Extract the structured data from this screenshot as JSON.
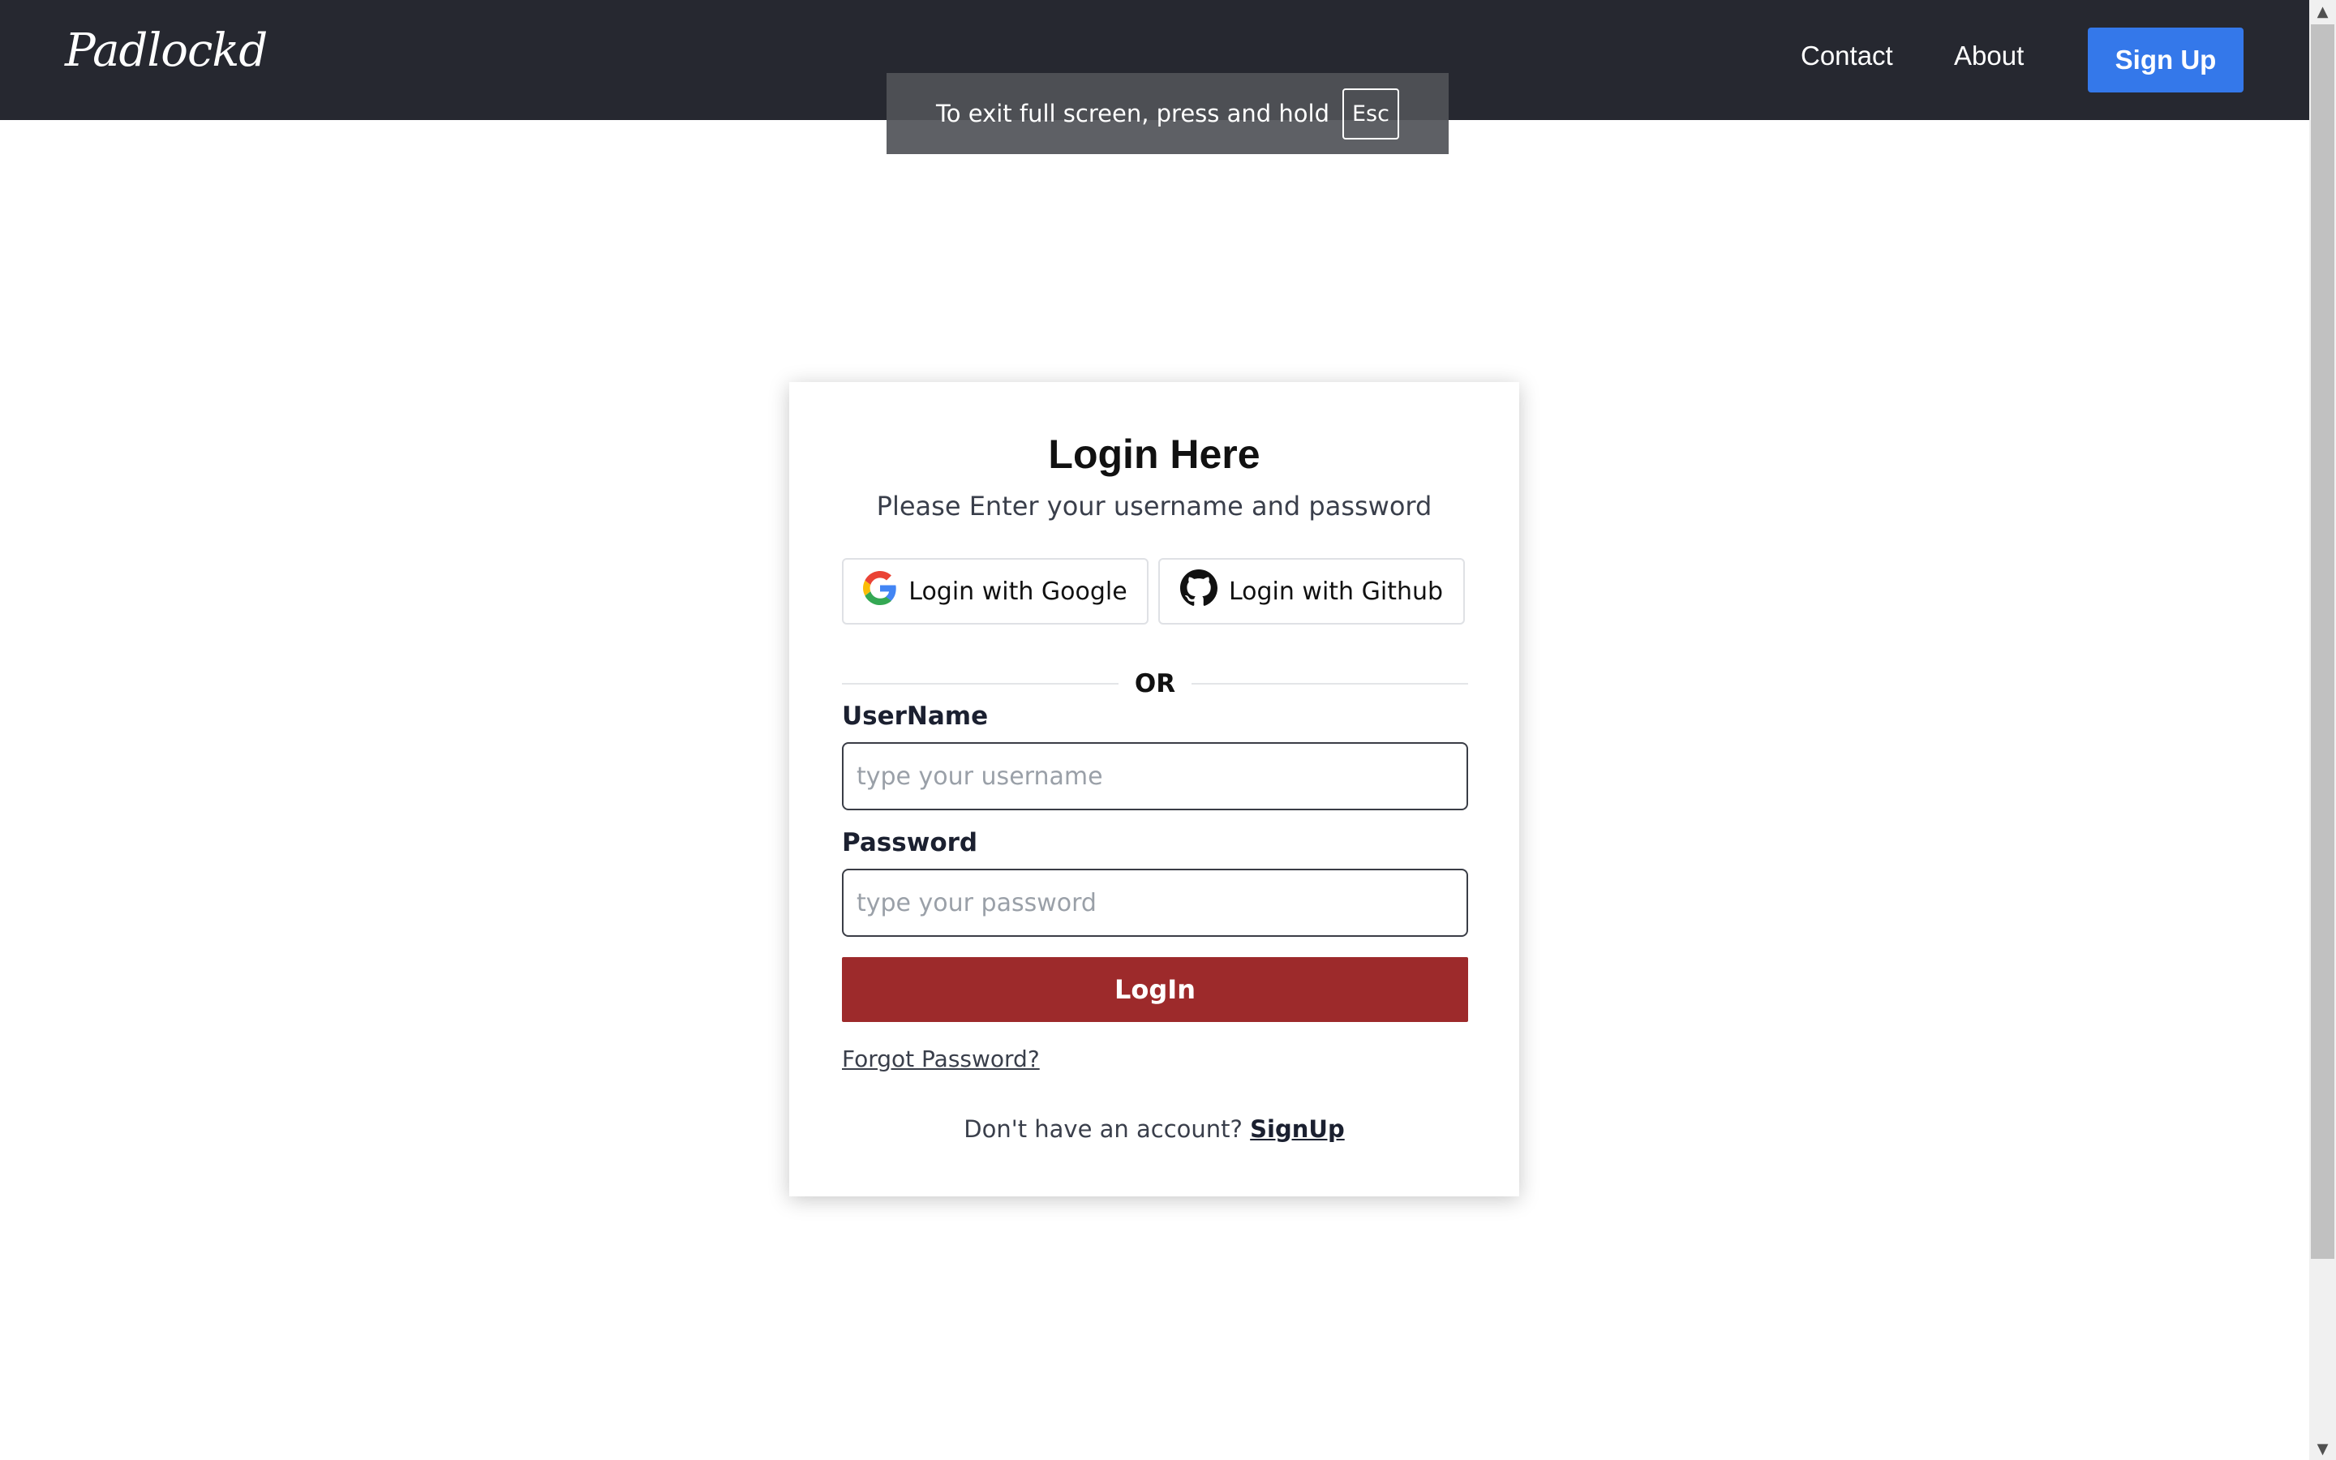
{
  "navbar": {
    "brand": "Padlockd",
    "links": {
      "contact": "Contact",
      "about": "About"
    },
    "signup_label": "Sign Up"
  },
  "fullscreen_toast": {
    "message": "To exit full screen, press and hold",
    "key": "Esc"
  },
  "login_card": {
    "title": "Login Here",
    "subtitle": "Please Enter your username and password",
    "google_label": "Login with Google",
    "github_label": "Login with Github",
    "divider": "OR",
    "username": {
      "label": "UserName",
      "placeholder": "type your username",
      "value": ""
    },
    "password": {
      "label": "Password",
      "placeholder": "type your password",
      "value": ""
    },
    "login_label": "LogIn",
    "forgot_label": "Forgot Password?",
    "signup_prompt": "Don't have an account?",
    "signup_link": "SignUp"
  },
  "colors": {
    "navbar_bg": "#262830",
    "signup_button": "#3478ea",
    "login_button": "#9d2a2b"
  }
}
